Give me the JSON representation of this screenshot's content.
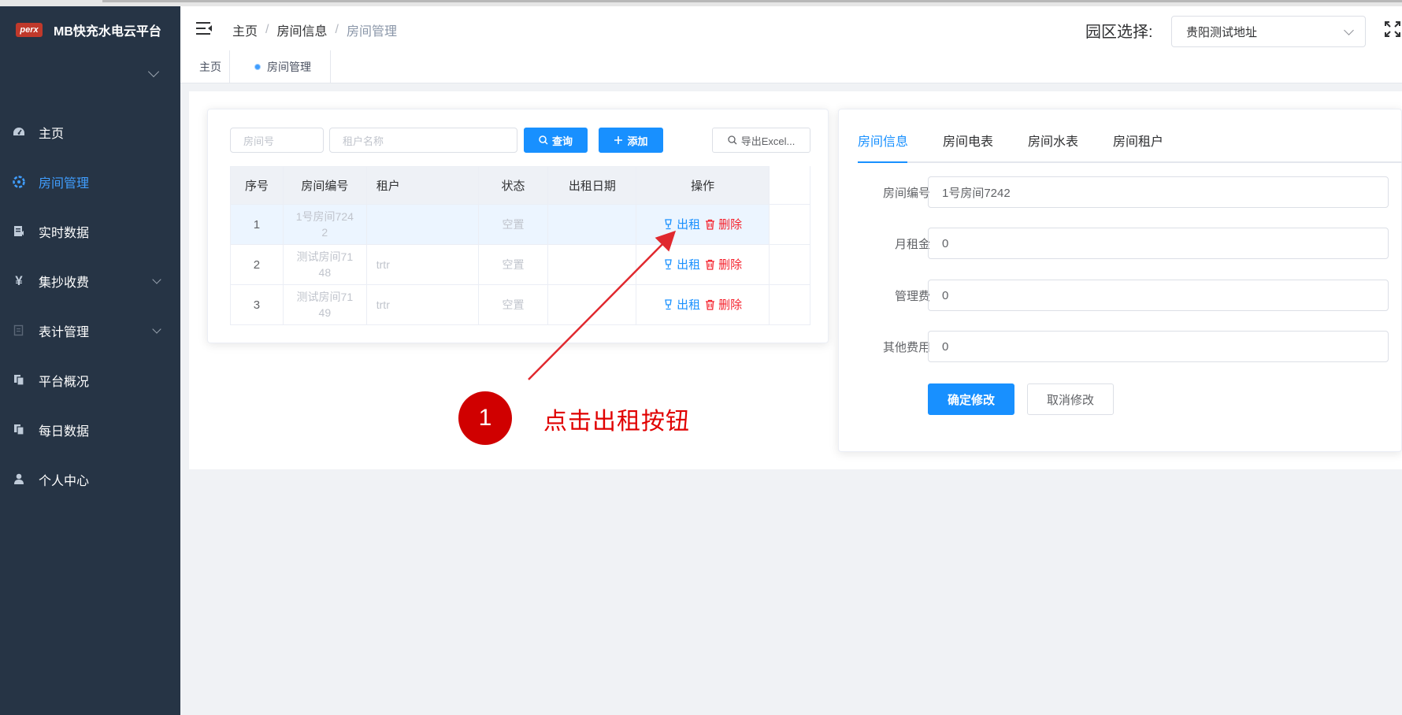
{
  "app": {
    "logo_mark": "perx",
    "title": "MB快充水电云平台"
  },
  "sidebar": {
    "items": [
      {
        "label": "主页",
        "icon": "dashboard-icon",
        "active": false,
        "has_children": false
      },
      {
        "label": "房间管理",
        "icon": "gear-icon",
        "active": true,
        "has_children": false
      },
      {
        "label": "实时数据",
        "icon": "document-icon",
        "active": false,
        "has_children": false
      },
      {
        "label": "集抄收费",
        "icon": "yen-icon",
        "active": false,
        "has_children": true
      },
      {
        "label": "表计管理",
        "icon": "meter-icon",
        "active": false,
        "has_children": true
      },
      {
        "label": "平台概况",
        "icon": "copy-icon",
        "active": false,
        "has_children": false
      },
      {
        "label": "每日数据",
        "icon": "copy-icon",
        "active": false,
        "has_children": false
      },
      {
        "label": "个人中心",
        "icon": "user-icon",
        "active": false,
        "has_children": false
      }
    ]
  },
  "header": {
    "breadcrumb": [
      "主页",
      "房间信息",
      "房间管理"
    ],
    "park_label": "园区选择:",
    "park_value": "贵阳测试地址"
  },
  "tags": {
    "home": "主页",
    "current": "房间管理"
  },
  "toolbar": {
    "room_no_placeholder": "房间号",
    "tenant_placeholder": "租户名称",
    "query_label": "查询",
    "add_label": "添加",
    "export_label": "导出Excel..."
  },
  "table": {
    "headers": [
      "序号",
      "房间编号",
      "租户",
      "状态",
      "出租日期",
      "操作"
    ],
    "rows": [
      {
        "index": "1",
        "room_line1": "1号房间724",
        "room_line2": "2",
        "tenant": "",
        "status": "空置",
        "date": "",
        "rent": "出租",
        "delete": "删除"
      },
      {
        "index": "2",
        "room_line1": "测试房间71",
        "room_line2": "48",
        "tenant": "trtr",
        "status": "空置",
        "date": "",
        "rent": "出租",
        "delete": "删除"
      },
      {
        "index": "3",
        "room_line1": "测试房间71",
        "room_line2": "49",
        "tenant": "trtr",
        "status": "空置",
        "date": "",
        "rent": "出租",
        "delete": "删除"
      }
    ]
  },
  "detail": {
    "tabs": [
      "房间信息",
      "房间电表",
      "房间水表",
      "房间租户"
    ],
    "fields": [
      {
        "label": "房间编号",
        "value": "1号房间7242"
      },
      {
        "label": "月租金",
        "value": "0"
      },
      {
        "label": "管理费",
        "value": "0"
      },
      {
        "label": "其他费用",
        "value": "0"
      }
    ],
    "confirm_label": "确定修改",
    "cancel_label": "取消修改"
  },
  "annotation": {
    "step": "1",
    "text": "点击出租按钮"
  },
  "colors": {
    "sidebar_bg": "#263445",
    "primary": "#1890ff",
    "danger": "#f5222d",
    "annotation": "#d00000"
  }
}
